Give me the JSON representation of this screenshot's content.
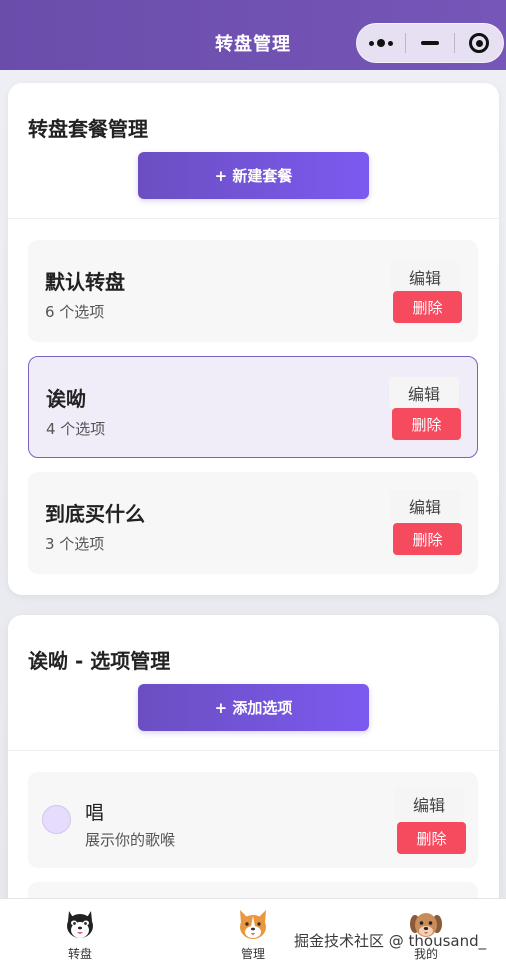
{
  "navbar": {
    "title": "转盘管理",
    "capsule_icons": [
      "more-dots-icon",
      "minimize-icon",
      "close-target-icon"
    ]
  },
  "packages_card": {
    "title": "转盘套餐管理",
    "new_button": "+ 新建套餐",
    "items": [
      {
        "name": "默认转盘",
        "count": "6 个选项",
        "edit": "编辑",
        "delete": "删除",
        "active": false
      },
      {
        "name": "诶呦",
        "count": "4 个选项",
        "edit": "编辑",
        "delete": "删除",
        "active": true
      },
      {
        "name": "到底买什么",
        "count": "3 个选项",
        "edit": "编辑",
        "delete": "删除",
        "active": false
      }
    ]
  },
  "options_card": {
    "title": "诶呦 - 选项管理",
    "add_button": "+ 添加选项",
    "items": [
      {
        "name": "唱",
        "desc": "展示你的歌喉",
        "edit": "编辑",
        "delete": "删除",
        "color": "#e6dcfb"
      }
    ]
  },
  "tabbar": {
    "tabs": [
      {
        "label": "转盘",
        "icon": "husky-dog-icon"
      },
      {
        "label": "管理",
        "icon": "corgi-dog-icon",
        "active": true
      },
      {
        "label": "我的",
        "icon": "brown-dog-icon"
      }
    ]
  },
  "watermark": "掘金技术社区 @ thousand_",
  "colors": {
    "navbar": "#6a4dab",
    "primary": "#7356d8",
    "danger": "#f64a5e",
    "active_border": "#7b63c2",
    "active_bg": "#f1edf8"
  }
}
